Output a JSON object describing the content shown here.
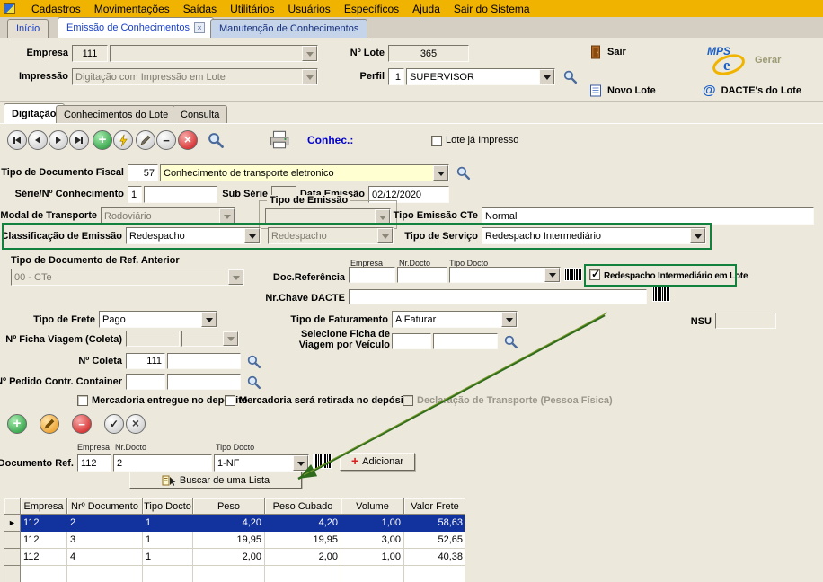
{
  "colors": {
    "menu_bg": "#EFB300",
    "panel_bg": "#ECE8DC",
    "field_yellow": "#FFFFD2",
    "selection_blue": "#12329E",
    "highlight_green": "#12813E",
    "annotation_arrow_green": "#2F6B1D",
    "tab_text_blue": "#1A41C8"
  },
  "menubar": {
    "items": [
      "Cadastros",
      "Movimentações",
      "Saídas",
      "Utilitários",
      "Usuários",
      "Específicos",
      "Ajuda",
      "Sair do Sistema"
    ]
  },
  "tabs": {
    "inicio": "Início",
    "emissao": "Emissão de Conhecimentos",
    "manutencao": "Manutenção de Conhecimentos"
  },
  "header": {
    "empresa_label": "Empresa",
    "empresa_value": "111",
    "lote_label": "Nº Lote",
    "lote_value": "365",
    "impressao_label": "Impressão",
    "impressao_value": "Digitação com Impressão em Lote",
    "perfil_label": "Perfil",
    "perfil_num": "1",
    "perfil_value": "SUPERVISOR",
    "sair_label": "Sair",
    "novo_lote_label": "Novo Lote",
    "gerar_label": "Gerar",
    "dactes_label": "DACTE's do Lote"
  },
  "subtabs": {
    "digitacao": "Digitação",
    "conhecimentos": "Conhecimentos do Lote",
    "consulta": "Consulta"
  },
  "toolbar": {
    "conhec_label": "Conhec.:",
    "lote_impresso_label": "Lote já Impresso",
    "lote_impresso_checked": false
  },
  "form": {
    "tipo_doc_fiscal_label": "Tipo de Documento Fiscal",
    "tipo_doc_fiscal_code": "57",
    "tipo_doc_fiscal_value": "Conhecimento de transporte eletronico",
    "serie_label": "Série/Nº Conhecimento",
    "serie_value": "1",
    "conhecimento_value": "",
    "sub_serie_label": "Sub Série",
    "sub_serie_value": "",
    "data_emissao_label": "Data Emissão",
    "data_emissao_value": "02/12/2020",
    "modal_label": "Modal de Transporte",
    "modal_value": "Rodoviário",
    "tipo_emissao_group_label": "Tipo de Emissão",
    "tipo_emissao_value": "",
    "tipo_emissao_cte_label": "Tipo Emissão CTe",
    "tipo_emissao_cte_value": "Normal",
    "classificacao_label": "Classificação de Emissão",
    "classificacao_value": "Redespacho",
    "classificacao_aux_value": "Redespacho",
    "tipo_servico_label": "Tipo de Serviço",
    "tipo_servico_value": "Redespacho Intermediário",
    "tipo_doc_ref_anterior_label": "Tipo de Documento de Ref. Anterior",
    "tipo_doc_ref_anterior_value": "00 - CTe",
    "doc_referencia_label": "Doc.Referência",
    "ref_col_empresa": "Empresa",
    "ref_col_nr_docto": "Nr.Docto",
    "ref_col_tipo_docto": "Tipo Docto",
    "ref_empresa_value": "",
    "ref_nr_docto_value": "",
    "ref_tipo_docto_value": "",
    "redespacho_lote_label": "Redespacho Intermediário em Lote",
    "redespacho_lote_checked": true,
    "nr_chave_label": "Nr.Chave DACTE",
    "nr_chave_value": "",
    "tipo_frete_label": "Tipo de Frete",
    "tipo_frete_value": "Pago",
    "tipo_faturamento_label": "Tipo de Faturamento",
    "tipo_faturamento_value": "A Faturar",
    "nsu_label": "NSU",
    "nsu_value": "",
    "ficha_viagem_label": "Nº Ficha Viagem (Coleta)",
    "selecione_ficha_line1": "Selecione Ficha de",
    "selecione_ficha_line2": "Viagem por Veículo",
    "num_coleta_label": "Nº Coleta",
    "num_coleta_value": "111",
    "pedido_container_label": "Nº Pedido Contr. Container",
    "chk_entregue_label": "Mercadoria entregue no depósito",
    "chk_entregue_checked": false,
    "chk_retirada_label": "Mercadoria será retirada no depósito",
    "chk_retirada_checked": false,
    "chk_declaracao_label": "Declaração de Transporte (Pessoa Física)",
    "chk_declaracao_checked": false
  },
  "docref": {
    "label": "Documento Ref.",
    "col_empresa": "Empresa",
    "col_nr_docto": "Nr.Docto",
    "col_tipo_docto": "Tipo Docto",
    "empresa_value": "112",
    "nr_docto_value": "2",
    "tipo_docto_value": "1-NF",
    "adicionar_label": "Adicionar",
    "buscar_label": "Buscar de uma Lista"
  },
  "grid": {
    "columns": [
      "Empresa",
      "Nrº Documento",
      "Tipo Docto",
      "Peso",
      "Peso Cubado",
      "Volume",
      "Valor Frete"
    ],
    "rows": [
      {
        "selected": true,
        "empresa": "112",
        "nr_documento": "2",
        "tipo_docto": "1",
        "peso": "4,20",
        "peso_cubado": "4,20",
        "volume": "1,00",
        "valor_frete": "58,63"
      },
      {
        "selected": false,
        "empresa": "112",
        "nr_documento": "3",
        "tipo_docto": "1",
        "peso": "19,95",
        "peso_cubado": "19,95",
        "volume": "3,00",
        "valor_frete": "52,65"
      },
      {
        "selected": false,
        "empresa": "112",
        "nr_documento": "4",
        "tipo_docto": "1",
        "peso": "2,00",
        "peso_cubado": "2,00",
        "volume": "1,00",
        "valor_frete": "40,38"
      }
    ]
  }
}
